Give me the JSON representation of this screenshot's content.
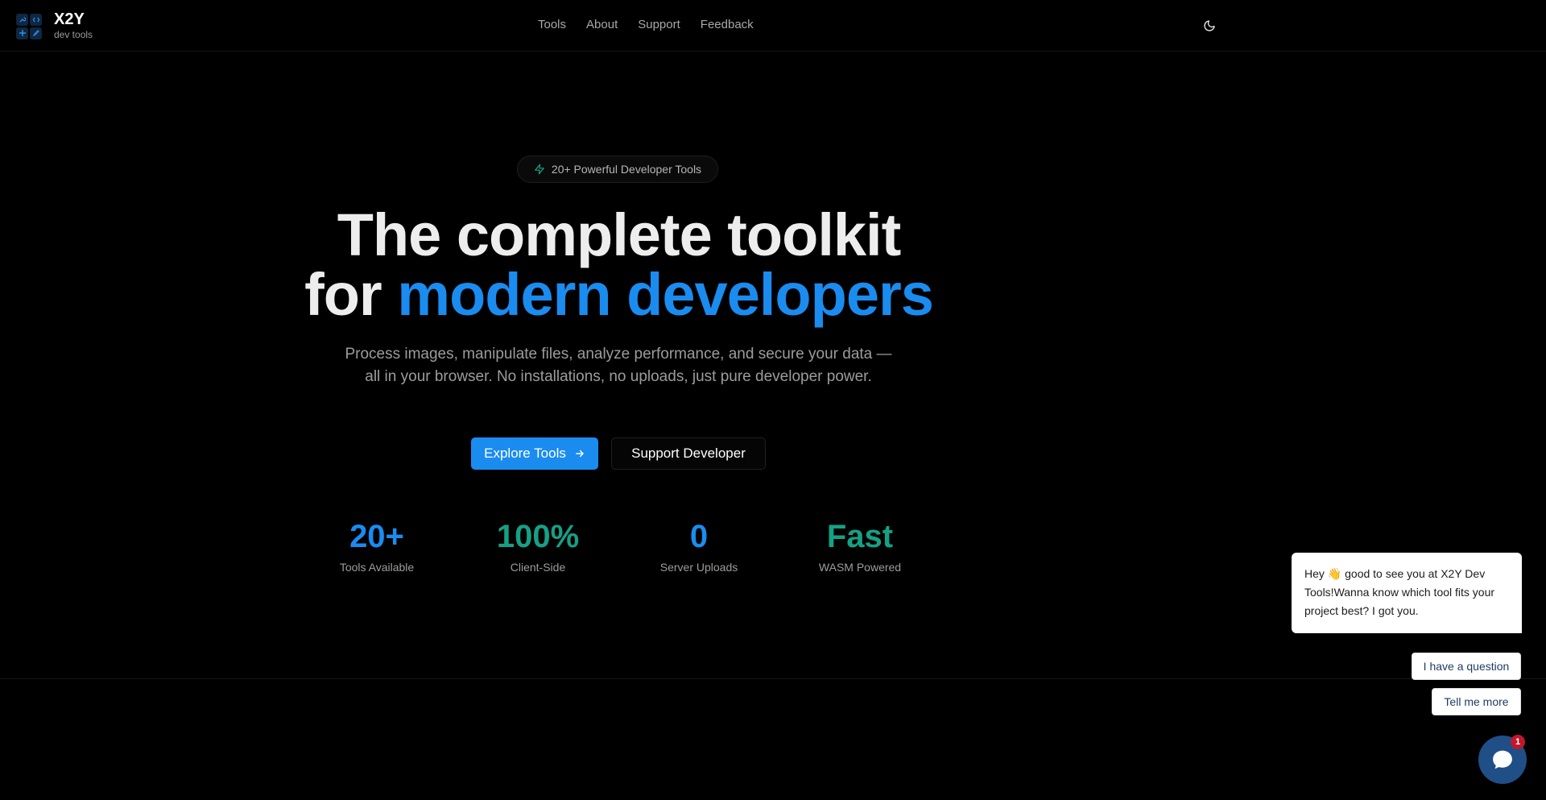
{
  "brand": {
    "name": "X2Y",
    "subtitle": "dev tools"
  },
  "nav": {
    "links": [
      {
        "label": "Tools"
      },
      {
        "label": "About"
      },
      {
        "label": "Support"
      },
      {
        "label": "Feedback"
      }
    ],
    "theme_toggle_icon": "moon-icon"
  },
  "hero": {
    "badge": "20+ Powerful Developer Tools",
    "title_line1": "The complete toolkit",
    "title_line2_plain": "for ",
    "title_line2_accent": "modern developers",
    "description": "Process images, manipulate files, analyze performance, and secure your data — all in your browser. No installations, no uploads, just pure developer power.",
    "primary_cta": "Explore Tools",
    "secondary_cta": "Support Developer"
  },
  "stats": [
    {
      "value": "20+",
      "label": "Tools Available",
      "color": "#1a8cf0"
    },
    {
      "value": "100%",
      "label": "Client-Side",
      "color": "#16a085"
    },
    {
      "value": "0",
      "label": "Server Uploads",
      "color": "#1a8cf0"
    },
    {
      "value": "Fast",
      "label": "WASM Powered",
      "color": "#16a085"
    }
  ],
  "chat": {
    "greeting_before": "Hey ",
    "greeting_emoji": "👋",
    "greeting_after": " good to see you at X2Y Dev Tools!Wanna know which tool fits your project best? I got you.",
    "options": [
      {
        "label": "I have a question"
      },
      {
        "label": "Tell me more"
      }
    ],
    "unread_count": "1"
  },
  "colors": {
    "accent_blue": "#1a8cf0",
    "accent_teal": "#16a085",
    "background": "#000000",
    "chat_launcher": "#1f4f86",
    "notification": "#c0172b"
  }
}
